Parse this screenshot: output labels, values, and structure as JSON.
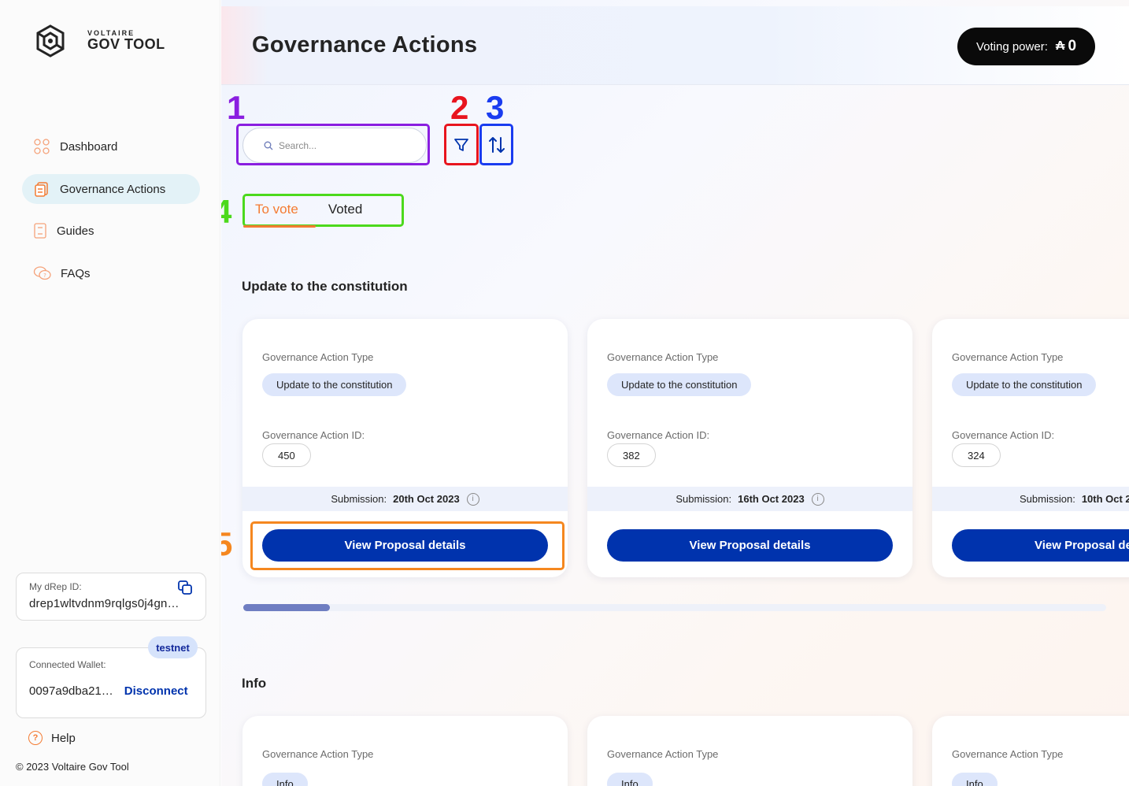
{
  "app": {
    "logo_small": "VOLTAIRE",
    "logo_big": "GOV TOOL"
  },
  "sidebar": {
    "items": [
      {
        "label": "Dashboard",
        "icon": "dashboard-icon"
      },
      {
        "label": "Governance Actions",
        "icon": "document-icon",
        "active": true
      },
      {
        "label": "Guides",
        "icon": "book-icon"
      },
      {
        "label": "FAQs",
        "icon": "chat-bubbles-icon"
      }
    ],
    "drep_label": "My dRep ID:",
    "drep_id": "drep1wltvdnm9rqlgs0j4gn…",
    "testnet_badge": "testnet",
    "wallet_label": "Connected Wallet:",
    "wallet_address": "0097a9dba21…",
    "disconnect_label": "Disconnect",
    "help_label": "Help",
    "copyright": "© 2023 Voltaire Gov Tool"
  },
  "header": {
    "title": "Governance Actions",
    "voting_power_label": "Voting power:",
    "voting_power_currency": "₳",
    "voting_power_value": "0"
  },
  "annotations": {
    "n1": "1",
    "n2": "2",
    "n3": "3",
    "n4": "4",
    "n5": "5"
  },
  "toolbar": {
    "search_placeholder": "Search..."
  },
  "tabs": {
    "to_vote": "To vote",
    "voted": "Voted"
  },
  "sections": [
    {
      "title": "Update to the constitution",
      "cards": [
        {
          "type_label": "Governance Action Type",
          "type": "Update to the constitution",
          "id_label": "Governance Action ID:",
          "id": "450",
          "submission_label": "Submission:",
          "submission_date": "20th Oct 2023",
          "button": "View Proposal details"
        },
        {
          "type_label": "Governance Action Type",
          "type": "Update to the constitution",
          "id_label": "Governance Action ID:",
          "id": "382",
          "submission_label": "Submission:",
          "submission_date": "16th Oct 2023",
          "button": "View Proposal details"
        },
        {
          "type_label": "Governance Action Type",
          "type": "Update to the constitution",
          "id_label": "Governance Action ID:",
          "id": "324",
          "submission_label": "Submission:",
          "submission_date": "10th Oct 2",
          "button": "View Proposal de"
        }
      ]
    },
    {
      "title": "Info",
      "cards": [
        {
          "type_label": "Governance Action Type",
          "type": "Info"
        },
        {
          "type_label": "Governance Action Type",
          "type": "Info"
        },
        {
          "type_label": "Governance Action Type",
          "type": "Info"
        }
      ]
    }
  ],
  "colors": {
    "primary_blue": "#0033ad",
    "accent_orange": "#f47b32",
    "annotation_purple": "#8a1ee0",
    "annotation_red": "#e8141e",
    "annotation_blue": "#1a3cf0",
    "annotation_green": "#4cd91c",
    "annotation_orange": "#f5871f"
  }
}
